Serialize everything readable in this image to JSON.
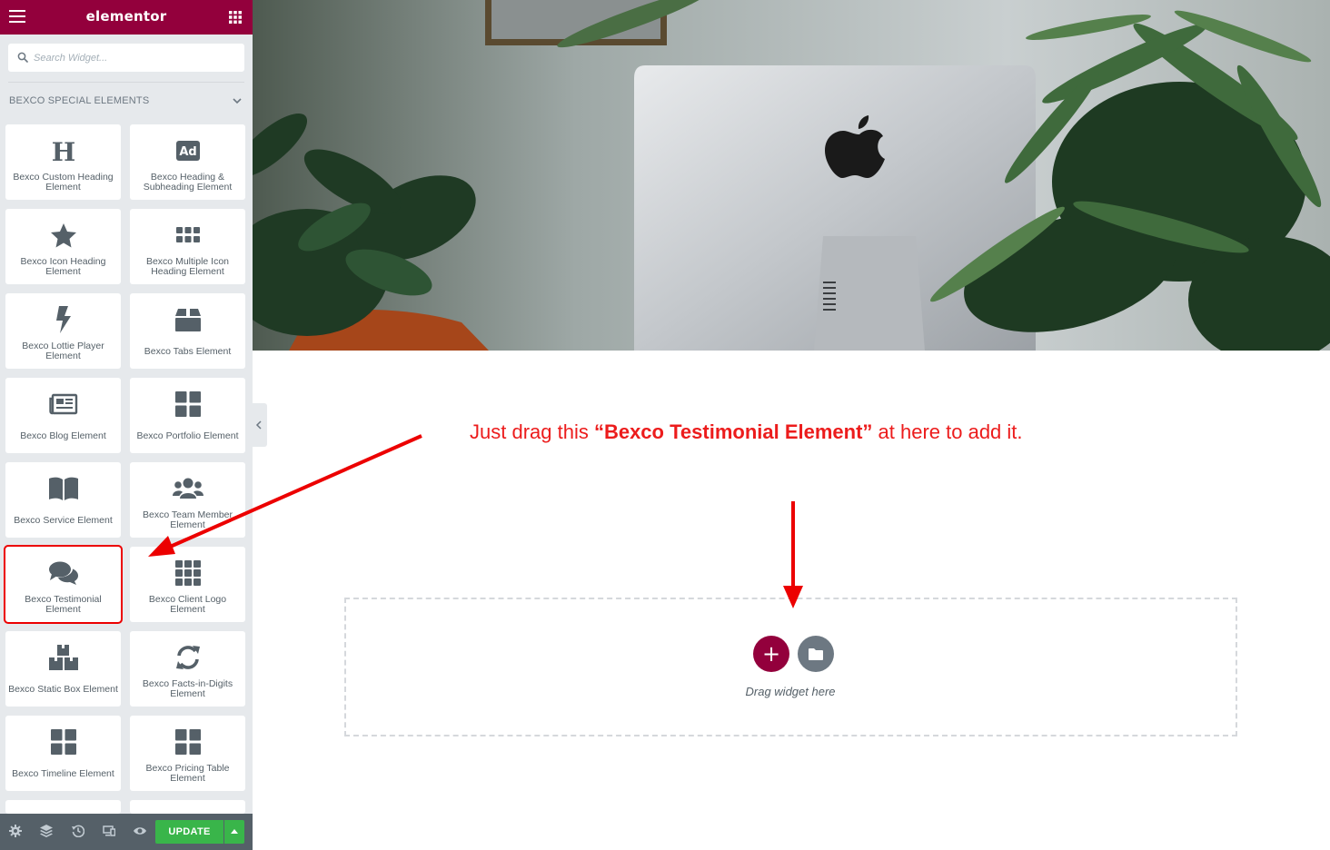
{
  "app": {
    "logo": "elementor"
  },
  "search": {
    "placeholder": "Search Widget..."
  },
  "section": {
    "title": "BEXCO SPECIAL ELEMENTS"
  },
  "widgets": [
    {
      "label": "Bexco Custom Heading Element",
      "icon": "heading-icon"
    },
    {
      "label": "Bexco Heading & Subheading Element",
      "icon": "ad-icon"
    },
    {
      "label": "Bexco Icon Heading Element",
      "icon": "star-icon"
    },
    {
      "label": "Bexco Multiple Icon Heading Element",
      "icon": "grid-dots-icon"
    },
    {
      "label": "Bexco Lottie Player Element",
      "icon": "bolt-icon"
    },
    {
      "label": "Bexco Tabs Element",
      "icon": "box-icon"
    },
    {
      "label": "Bexco Blog Element",
      "icon": "newspaper-icon"
    },
    {
      "label": "Bexco Portfolio Element",
      "icon": "grid-icon"
    },
    {
      "label": "Bexco Service Element",
      "icon": "book-icon"
    },
    {
      "label": "Bexco Team Member Element",
      "icon": "users-icon"
    },
    {
      "label": "Bexco Testimonial Element",
      "icon": "comments-icon"
    },
    {
      "label": "Bexco Client Logo Element",
      "icon": "grid-3x3-icon"
    },
    {
      "label": "Bexco Static Box Element",
      "icon": "boxes-icon"
    },
    {
      "label": "Bexco Facts-in-Digits Element",
      "icon": "sync-icon"
    },
    {
      "label": "Bexco Timeline Element",
      "icon": "grid-icon"
    },
    {
      "label": "Bexco Pricing Table Element",
      "icon": "grid-icon"
    }
  ],
  "footer": {
    "update_label": "UPDATE"
  },
  "canvas": {
    "instruction_prefix": "Just drag this ",
    "instruction_bold": "“Bexco Testimonial Element”",
    "instruction_suffix": " at here to add it.",
    "drop_text": "Drag widget here"
  },
  "colors": {
    "brand": "#93003c",
    "update_green": "#39b54a",
    "annotation_red": "#ec1c1c"
  }
}
